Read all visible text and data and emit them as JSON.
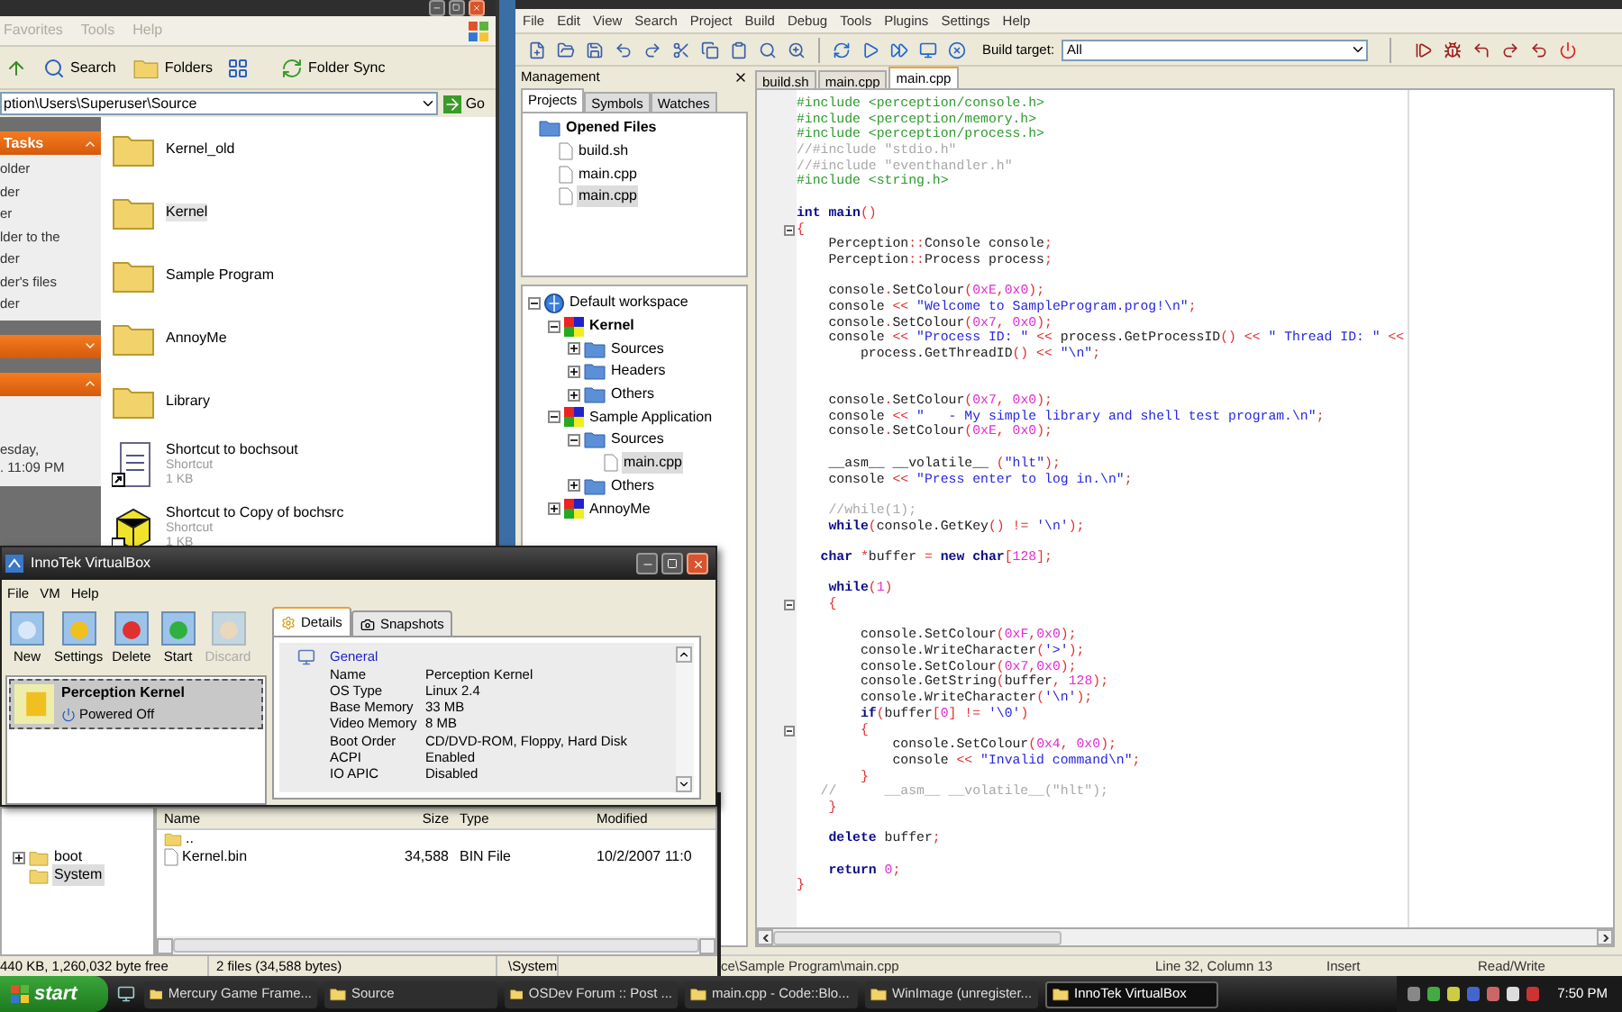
{
  "explorer": {
    "menu": [
      "Favorites",
      "Tools",
      "Help"
    ],
    "toolbar": [
      "Search",
      "Folders",
      "Folder Sync"
    ],
    "address": "ption\\Users\\Superuser\\Source",
    "go": "Go",
    "task_sections": [
      {
        "title": "Tasks",
        "expanded": true,
        "items": [
          "older",
          "der",
          "er",
          "lder to the",
          "der",
          "der's files",
          "der"
        ]
      },
      {
        "expanded": false
      },
      {
        "expanded": true,
        "items": [
          "esday,",
          ". 11:09 PM"
        ]
      }
    ],
    "files": [
      {
        "name": "Kernel_old",
        "kind": "folder",
        "selected": false
      },
      {
        "name": "Kernel",
        "kind": "folder",
        "selected": true
      },
      {
        "name": "Sample Program",
        "kind": "folder",
        "selected": false
      },
      {
        "name": "AnnoyMe",
        "kind": "folder",
        "selected": false
      },
      {
        "name": "Library",
        "kind": "folder",
        "selected": false
      },
      {
        "name": "Shortcut to bochsout",
        "kind": "shortcut-doc",
        "type": "Shortcut",
        "size": "1 KB",
        "selected": false
      },
      {
        "name": "Shortcut to Copy of bochsrc",
        "kind": "shortcut-box",
        "type": "Shortcut",
        "size": "1 KB",
        "selected": false
      }
    ]
  },
  "codeblocks": {
    "menu": [
      "File",
      "Edit",
      "View",
      "Search",
      "Project",
      "Build",
      "Debug",
      "Tools",
      "Plugins",
      "Settings",
      "Help"
    ],
    "build_target_label": "Build target:",
    "build_target": "All",
    "management": {
      "title": "Management",
      "tabs": [
        {
          "label": "Projects",
          "selected": true
        },
        {
          "label": "Symbols",
          "selected": false
        },
        {
          "label": "Watches",
          "selected": false
        }
      ],
      "opened_files": {
        "label": "Opened Files",
        "kind": "folder",
        "bold": true,
        "selected": false,
        "children": [
          {
            "label": "build.sh",
            "kind": "file",
            "selected": false
          },
          {
            "label": "main.cpp",
            "kind": "file",
            "selected": false
          },
          {
            "label": "main.cpp",
            "kind": "file",
            "selected": true
          }
        ]
      },
      "workspace": {
        "label": "Default workspace",
        "kind": "workspace",
        "expanded": true,
        "selected": false,
        "children": [
          {
            "label": "Kernel",
            "kind": "project",
            "bold": true,
            "expanded": true,
            "selected": false,
            "children": [
              {
                "label": "Sources",
                "kind": "folder",
                "expanded": false,
                "selected": false
              },
              {
                "label": "Headers",
                "kind": "folder",
                "expanded": false,
                "selected": false
              },
              {
                "label": "Others",
                "kind": "folder",
                "expanded": false,
                "selected": false
              }
            ]
          },
          {
            "label": "Sample Application",
            "kind": "project",
            "bold": false,
            "expanded": true,
            "selected": false,
            "children": [
              {
                "label": "Sources",
                "kind": "folder",
                "expanded": true,
                "selected": false,
                "children": [
                  {
                    "label": "main.cpp",
                    "kind": "file",
                    "selected": true
                  }
                ]
              },
              {
                "label": "Others",
                "kind": "folder",
                "expanded": false,
                "selected": false
              }
            ]
          },
          {
            "label": "AnnoyMe",
            "kind": "project",
            "bold": false,
            "expanded": false,
            "selected": false
          }
        ]
      }
    },
    "editor_tabs": [
      {
        "label": "build.sh",
        "selected": false
      },
      {
        "label": "main.cpp",
        "selected": false
      },
      {
        "label": "main.cpp",
        "selected": true
      }
    ],
    "code": [
      {
        "fold": false,
        "spans": [
          {
            "kind": "pp",
            "text": "#include <perception/console.h>"
          }
        ]
      },
      {
        "fold": false,
        "spans": [
          {
            "kind": "pp",
            "text": "#include <perception/memory.h>"
          }
        ]
      },
      {
        "fold": false,
        "spans": [
          {
            "kind": "pp",
            "text": "#include <perception/process.h>"
          }
        ]
      },
      {
        "fold": false,
        "spans": [
          {
            "kind": "cm",
            "text": "//#include \"stdio.h\""
          }
        ]
      },
      {
        "fold": false,
        "spans": [
          {
            "kind": "cm",
            "text": "//#include \"eventhandler.h\""
          }
        ]
      },
      {
        "fold": false,
        "spans": [
          {
            "kind": "pp",
            "text": "#include <string.h>"
          }
        ]
      },
      {
        "fold": false
      },
      {
        "fold": false,
        "spans": [
          {
            "kind": "kw",
            "text": "int main"
          },
          {
            "kind": "op",
            "text": "()"
          }
        ]
      },
      {
        "fold": true,
        "spans": [
          {
            "kind": "op",
            "text": "{"
          }
        ]
      },
      {
        "fold": false,
        "spans": [
          {
            "kind": "tx",
            "text": "    Perception"
          },
          {
            "kind": "op",
            "text": "::"
          },
          {
            "kind": "tx",
            "text": "Console console"
          },
          {
            "kind": "op",
            "text": ";"
          }
        ]
      },
      {
        "fold": false,
        "spans": [
          {
            "kind": "tx",
            "text": "    Perception"
          },
          {
            "kind": "op",
            "text": "::"
          },
          {
            "kind": "tx",
            "text": "Process process"
          },
          {
            "kind": "op",
            "text": ";"
          }
        ]
      },
      {
        "fold": false
      },
      {
        "fold": false,
        "spans": [
          {
            "kind": "tx",
            "text": "    console"
          },
          {
            "kind": "op",
            "text": "."
          },
          {
            "kind": "tx",
            "text": "SetColour"
          },
          {
            "kind": "op",
            "text": "("
          },
          {
            "kind": "num",
            "text": "0xE"
          },
          {
            "kind": "op",
            "text": ","
          },
          {
            "kind": "num",
            "text": "0x0"
          },
          {
            "kind": "op",
            "text": ");"
          }
        ]
      },
      {
        "fold": false,
        "spans": [
          {
            "kind": "tx",
            "text": "    console "
          },
          {
            "kind": "op",
            "text": "<<"
          },
          {
            "kind": "str",
            "text": " \"Welcome to SampleProgram.prog!\\n\""
          },
          {
            "kind": "op",
            "text": ";"
          }
        ]
      },
      {
        "fold": false,
        "spans": [
          {
            "kind": "tx",
            "text": "    console"
          },
          {
            "kind": "op",
            "text": "."
          },
          {
            "kind": "tx",
            "text": "SetColour"
          },
          {
            "kind": "op",
            "text": "("
          },
          {
            "kind": "num",
            "text": "0x7"
          },
          {
            "kind": "op",
            "text": ", "
          },
          {
            "kind": "num",
            "text": "0x0"
          },
          {
            "kind": "op",
            "text": ");"
          }
        ]
      },
      {
        "fold": false,
        "spans": [
          {
            "kind": "tx",
            "text": "    console "
          },
          {
            "kind": "op",
            "text": "<<"
          },
          {
            "kind": "str",
            "text": " \"Process ID: \" "
          },
          {
            "kind": "op",
            "text": "<<"
          },
          {
            "kind": "tx",
            "text": " process.GetProcessID"
          },
          {
            "kind": "op",
            "text": "() <<"
          },
          {
            "kind": "str",
            "text": " \" Thread ID: \" "
          },
          {
            "kind": "op",
            "text": "<<"
          }
        ]
      },
      {
        "fold": false,
        "spans": [
          {
            "kind": "tx",
            "text": "        process.GetThreadID"
          },
          {
            "kind": "op",
            "text": "() <<"
          },
          {
            "kind": "str",
            "text": " \"\\n\""
          },
          {
            "kind": "op",
            "text": ";"
          }
        ]
      },
      {
        "fold": false
      },
      {
        "fold": false
      },
      {
        "fold": false,
        "spans": [
          {
            "kind": "tx",
            "text": "    console"
          },
          {
            "kind": "op",
            "text": "."
          },
          {
            "kind": "tx",
            "text": "SetColour"
          },
          {
            "kind": "op",
            "text": "("
          },
          {
            "kind": "num",
            "text": "0x7"
          },
          {
            "kind": "op",
            "text": ", "
          },
          {
            "kind": "num",
            "text": "0x0"
          },
          {
            "kind": "op",
            "text": ");"
          }
        ]
      },
      {
        "fold": false,
        "spans": [
          {
            "kind": "tx",
            "text": "    console "
          },
          {
            "kind": "op",
            "text": "<<"
          },
          {
            "kind": "str",
            "text": " \"   - My simple library and shell test program.\\n\""
          },
          {
            "kind": "op",
            "text": ";"
          }
        ]
      },
      {
        "fold": false,
        "spans": [
          {
            "kind": "tx",
            "text": "    console"
          },
          {
            "kind": "op",
            "text": "."
          },
          {
            "kind": "tx",
            "text": "SetColour"
          },
          {
            "kind": "op",
            "text": "("
          },
          {
            "kind": "num",
            "text": "0xE"
          },
          {
            "kind": "op",
            "text": ", "
          },
          {
            "kind": "num",
            "text": "0x0"
          },
          {
            "kind": "op",
            "text": ");"
          }
        ]
      },
      {
        "fold": false
      },
      {
        "fold": false,
        "spans": [
          {
            "kind": "tx",
            "text": "    __asm__ __volatile__ "
          },
          {
            "kind": "op",
            "text": "("
          },
          {
            "kind": "str",
            "text": "\"hlt\""
          },
          {
            "kind": "op",
            "text": ");"
          }
        ]
      },
      {
        "fold": false,
        "spans": [
          {
            "kind": "tx",
            "text": "    console "
          },
          {
            "kind": "op",
            "text": "<<"
          },
          {
            "kind": "str",
            "text": " \"Press enter to log in.\\n\""
          },
          {
            "kind": "op",
            "text": ";"
          }
        ]
      },
      {
        "fold": false
      },
      {
        "fold": false,
        "spans": [
          {
            "kind": "cm",
            "text": "    //while(1);"
          }
        ]
      },
      {
        "fold": false,
        "spans": [
          {
            "kind": "kw",
            "text": "    while"
          },
          {
            "kind": "op",
            "text": "("
          },
          {
            "kind": "tx",
            "text": "console.GetKey"
          },
          {
            "kind": "op",
            "text": "() != "
          },
          {
            "kind": "str",
            "text": "'\\n'"
          },
          {
            "kind": "op",
            "text": ");"
          }
        ]
      },
      {
        "fold": false
      },
      {
        "fold": false,
        "spans": [
          {
            "kind": "kw",
            "text": "   char "
          },
          {
            "kind": "op",
            "text": "*"
          },
          {
            "kind": "tx",
            "text": "buffer "
          },
          {
            "kind": "op",
            "text": "= "
          },
          {
            "kind": "kw",
            "text": "new char"
          },
          {
            "kind": "op",
            "text": "["
          },
          {
            "kind": "num",
            "text": "128"
          },
          {
            "kind": "op",
            "text": "];"
          }
        ]
      },
      {
        "fold": false
      },
      {
        "fold": false,
        "spans": [
          {
            "kind": "kw",
            "text": "    while"
          },
          {
            "kind": "op",
            "text": "("
          },
          {
            "kind": "num",
            "text": "1"
          },
          {
            "kind": "op",
            "text": ")"
          }
        ]
      },
      {
        "fold": true,
        "spans": [
          {
            "kind": "op",
            "text": "    {"
          }
        ]
      },
      {
        "fold": false
      },
      {
        "fold": false,
        "spans": [
          {
            "kind": "tx",
            "text": "        console.SetColour"
          },
          {
            "kind": "op",
            "text": "("
          },
          {
            "kind": "num",
            "text": "0xF"
          },
          {
            "kind": "op",
            "text": ","
          },
          {
            "kind": "num",
            "text": "0x0"
          },
          {
            "kind": "op",
            "text": ");"
          }
        ]
      },
      {
        "fold": false,
        "spans": [
          {
            "kind": "tx",
            "text": "        console.WriteCharacter"
          },
          {
            "kind": "op",
            "text": "("
          },
          {
            "kind": "str",
            "text": "'>'"
          },
          {
            "kind": "op",
            "text": ");"
          }
        ]
      },
      {
        "fold": false,
        "spans": [
          {
            "kind": "tx",
            "text": "        console.SetColour"
          },
          {
            "kind": "op",
            "text": "("
          },
          {
            "kind": "num",
            "text": "0x7"
          },
          {
            "kind": "op",
            "text": ","
          },
          {
            "kind": "num",
            "text": "0x0"
          },
          {
            "kind": "op",
            "text": ");"
          }
        ]
      },
      {
        "fold": false,
        "spans": [
          {
            "kind": "tx",
            "text": "        console.GetString"
          },
          {
            "kind": "op",
            "text": "("
          },
          {
            "kind": "tx",
            "text": "buffer"
          },
          {
            "kind": "op",
            "text": ", "
          },
          {
            "kind": "num",
            "text": "128"
          },
          {
            "kind": "op",
            "text": ");"
          }
        ]
      },
      {
        "fold": false,
        "spans": [
          {
            "kind": "tx",
            "text": "        console.WriteCharacter"
          },
          {
            "kind": "op",
            "text": "("
          },
          {
            "kind": "str",
            "text": "'\\n'"
          },
          {
            "kind": "op",
            "text": ");"
          }
        ]
      },
      {
        "fold": false,
        "spans": [
          {
            "kind": "kw",
            "text": "        if"
          },
          {
            "kind": "op",
            "text": "("
          },
          {
            "kind": "tx",
            "text": "buffer"
          },
          {
            "kind": "op",
            "text": "["
          },
          {
            "kind": "num",
            "text": "0"
          },
          {
            "kind": "op",
            "text": "] != "
          },
          {
            "kind": "str",
            "text": "'\\0'"
          },
          {
            "kind": "op",
            "text": ")"
          }
        ]
      },
      {
        "fold": true,
        "spans": [
          {
            "kind": "op",
            "text": "        {"
          }
        ]
      },
      {
        "fold": false,
        "spans": [
          {
            "kind": "tx",
            "text": "            console.SetColour"
          },
          {
            "kind": "op",
            "text": "("
          },
          {
            "kind": "num",
            "text": "0x4"
          },
          {
            "kind": "op",
            "text": ", "
          },
          {
            "kind": "num",
            "text": "0x0"
          },
          {
            "kind": "op",
            "text": ");"
          }
        ]
      },
      {
        "fold": false,
        "spans": [
          {
            "kind": "tx",
            "text": "            console "
          },
          {
            "kind": "op",
            "text": "<<"
          },
          {
            "kind": "str",
            "text": " \"Invalid command\\n\""
          },
          {
            "kind": "op",
            "text": ";"
          }
        ]
      },
      {
        "fold": false,
        "spans": [
          {
            "kind": "op",
            "text": "        }"
          }
        ]
      },
      {
        "fold": false,
        "spans": [
          {
            "kind": "cm",
            "text": "   //      __asm__ __volatile__(\"hlt\");"
          }
        ]
      },
      {
        "fold": false,
        "spans": [
          {
            "kind": "op",
            "text": "    }"
          }
        ]
      },
      {
        "fold": false
      },
      {
        "fold": false,
        "spans": [
          {
            "kind": "kw",
            "text": "    delete "
          },
          {
            "kind": "tx",
            "text": "buffer"
          },
          {
            "kind": "op",
            "text": ";"
          }
        ]
      },
      {
        "fold": false
      },
      {
        "fold": false,
        "spans": [
          {
            "kind": "kw",
            "text": "    return "
          },
          {
            "kind": "num",
            "text": "0"
          },
          {
            "kind": "op",
            "text": ";"
          }
        ]
      },
      {
        "fold": false,
        "spans": [
          {
            "kind": "op",
            "text": "}"
          }
        ]
      }
    ],
    "status": [
      "ce\\Sample Program\\main.cpp",
      "Line 32, Column 13",
      "Insert",
      "Read/Write"
    ]
  },
  "winimage": {
    "tree": [
      {
        "label": "boot",
        "kind": "collapsed",
        "selected": false
      },
      {
        "label": "System",
        "kind": "leaf",
        "selected": true
      }
    ],
    "columns": [
      "Name",
      "Size",
      "Type",
      "Modified"
    ],
    "rows": [
      {
        "name": "..",
        "kind": "parent"
      },
      {
        "name": "Kernel.bin",
        "kind": "file",
        "size": "34,588",
        "type": "BIN File",
        "modified": "10/2/2007 11:0"
      }
    ],
    "status": [
      "440 KB, 1,260,032 byte free",
      "2 files (34,588 bytes)",
      "\\System"
    ]
  },
  "virtualbox": {
    "title": "InnoTek VirtualBox",
    "menu": [
      "File",
      "VM",
      "Help"
    ],
    "tools": [
      {
        "label": "New",
        "kind": "new",
        "disabled": false
      },
      {
        "label": "Settings",
        "kind": "settings",
        "disabled": false
      },
      {
        "label": "Delete",
        "kind": "delete",
        "disabled": false
      },
      {
        "label": "Start",
        "kind": "start",
        "disabled": false
      },
      {
        "label": "Discard",
        "kind": "discard",
        "disabled": true
      }
    ],
    "vms": [
      {
        "name": "Perception Kernel",
        "state": "Powered Off",
        "selected": true
      }
    ],
    "tabs": [
      {
        "label": "Details",
        "kind": "details",
        "selected": true
      },
      {
        "label": "Snapshots",
        "kind": "snapshots",
        "selected": false
      }
    ],
    "details": {
      "section": "General",
      "rows": [
        [
          "Name",
          "Perception Kernel"
        ],
        [
          "OS Type",
          "Linux 2.4"
        ],
        [
          "Base Memory",
          "33 MB"
        ],
        [
          "Video Memory",
          "8 MB"
        ],
        [
          "Boot Order",
          "CD/DVD-ROM, Floppy, Hard Disk"
        ],
        [
          "ACPI",
          "Enabled"
        ],
        [
          "IO APIC",
          "Disabled"
        ]
      ]
    }
  },
  "taskbar": {
    "start": "start",
    "tasks": [
      {
        "label": "Mercury Game Frame...",
        "selected": false
      },
      {
        "label": "Source",
        "selected": false
      },
      {
        "label": "OSDev Forum :: Post ...",
        "selected": false
      },
      {
        "label": "main.cpp - Code::Blo...",
        "selected": false
      },
      {
        "label": "WinImage (unregister...",
        "selected": false
      },
      {
        "label": "InnoTek VirtualBox",
        "selected": true
      }
    ],
    "clock": "7:50 PM"
  }
}
